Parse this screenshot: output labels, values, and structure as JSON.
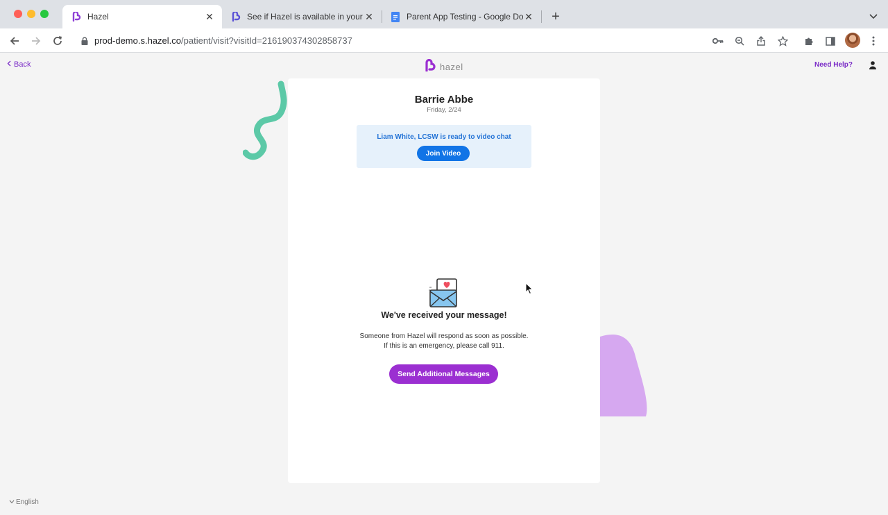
{
  "browser": {
    "tabs": [
      {
        "title": "Hazel",
        "active": true
      },
      {
        "title": "See if Hazel is available in your",
        "active": false
      },
      {
        "title": "Parent App Testing - Google Do",
        "active": false
      }
    ],
    "url_host": "prod-demo.s.hazel.co",
    "url_path": "/patient/visit?visitId=216190374302858737"
  },
  "header": {
    "back_label": "Back",
    "logo_text": "hazel",
    "help_label": "Need Help?"
  },
  "visit": {
    "patient_name": "Barrie Abbe",
    "date": "Friday, 2/24",
    "video_banner_text": "Liam White, LCSW is ready to video chat",
    "join_label": "Join Video"
  },
  "confirmation": {
    "title": "We've received your message!",
    "line1": "Someone from Hazel will respond as soon as possible.",
    "line2": "If this is an emergency, please call 911.",
    "send_label": "Send Additional Messages"
  },
  "footer": {
    "language": "English"
  },
  "colors": {
    "brand_purple": "#9b2fd1",
    "link_purple": "#7a2bc7",
    "video_blue": "#1174e6",
    "banner_bg": "#e6f1fb",
    "squiggle_teal": "#5cc9a7",
    "blob_lavender": "#d6a8f0"
  },
  "icons": {
    "favicon": "hazel-logo-icon",
    "doc_favicon": "google-docs-icon",
    "envelope": "envelope-heart-icon",
    "profile": "profile-avatar-icon",
    "user": "user-icon"
  }
}
